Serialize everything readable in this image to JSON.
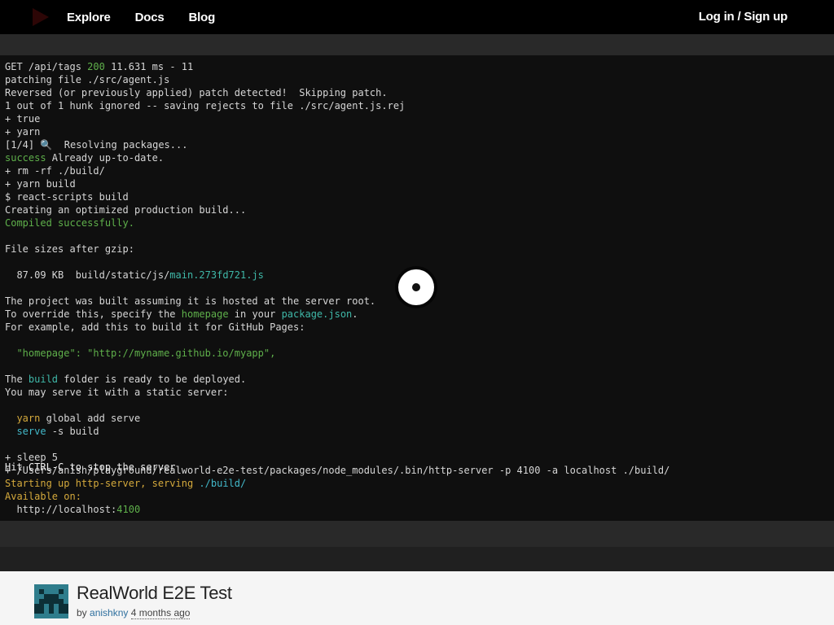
{
  "nav": {
    "links": [
      "Explore",
      "Docs",
      "Blog"
    ],
    "login": "Log in / Sign up",
    "brand_color": "#d40000"
  },
  "terminal": {
    "lines": [
      [
        {
          "t": "GET /api/tags "
        },
        {
          "t": "200",
          "c": "green"
        },
        {
          "t": " 11.631 ms - 11"
        }
      ],
      [
        {
          "t": "patching file ./src/agent.js"
        }
      ],
      [
        {
          "t": "Reversed (or previously applied) patch detected!  Skipping patch."
        }
      ],
      [
        {
          "t": "1 out of 1 hunk ignored -- saving rejects to file ./src/agent.js.rej"
        }
      ],
      [
        {
          "t": "+ true"
        }
      ],
      [
        {
          "t": "+ yarn"
        }
      ],
      [
        {
          "t": "[1/4] 🔍  Resolving packages..."
        }
      ],
      [
        {
          "t": "success",
          "c": "green"
        },
        {
          "t": " Already up-to-date."
        }
      ],
      [
        {
          "t": "+ rm -rf ./build/"
        }
      ],
      [
        {
          "t": "+ yarn build"
        }
      ],
      [
        {
          "t": "$ react-scripts build"
        }
      ],
      [
        {
          "t": "Creating an optimized production build..."
        }
      ],
      [
        {
          "t": "Compiled successfully.",
          "c": "green"
        }
      ],
      [
        {
          "t": ""
        }
      ],
      [
        {
          "t": "File sizes after gzip:"
        }
      ],
      [
        {
          "t": ""
        }
      ],
      [
        {
          "t": "  87.09 KB  build/static/js/"
        },
        {
          "t": "main.273fd721.js",
          "c": "teal"
        }
      ],
      [
        {
          "t": ""
        }
      ],
      [
        {
          "t": "The project was built assuming it is hosted at the server root."
        }
      ],
      [
        {
          "t": "To override this, specify the "
        },
        {
          "t": "homepage",
          "c": "green"
        },
        {
          "t": " in your "
        },
        {
          "t": "package.json",
          "c": "teal"
        },
        {
          "t": "."
        }
      ],
      [
        {
          "t": "For example, add this to build it for GitHub Pages:"
        }
      ],
      [
        {
          "t": ""
        }
      ],
      [
        {
          "t": "  \"homepage\": \"http://myname.github.io/myapp\",",
          "c": "green"
        }
      ],
      [
        {
          "t": ""
        }
      ],
      [
        {
          "t": "The "
        },
        {
          "t": "build",
          "c": "teal"
        },
        {
          "t": " folder is ready to be deployed."
        }
      ],
      [
        {
          "t": "You may serve it with a static server:"
        }
      ],
      [
        {
          "t": ""
        }
      ],
      [
        {
          "t": "  "
        },
        {
          "t": "yarn",
          "c": "yellow"
        },
        {
          "t": " global add serve"
        }
      ],
      [
        {
          "t": "  "
        },
        {
          "t": "serve",
          "c": "cyan"
        },
        {
          "t": " -s build"
        }
      ],
      [
        {
          "t": ""
        }
      ],
      [
        {
          "t": "+ sleep 5"
        }
      ],
      [
        {
          "t": "+ /Users/anish/playground/realworld-e2e-test/packages/node_modules/.bin/http-server -p 4100 -a localhost ./build/"
        }
      ],
      [
        {
          "t": "Starting up http-server, serving ",
          "c": "yellow"
        },
        {
          "t": "./build/",
          "c": "cyan"
        }
      ],
      [
        {
          "t": "Available on:",
          "c": "yellow"
        }
      ],
      [
        {
          "t": "  http://localhost:"
        },
        {
          "t": "4100",
          "c": "green"
        }
      ]
    ],
    "last_line": "Hit CTRL-C to stop the server"
  },
  "player": {
    "play_icon": "play-icon"
  },
  "footer": {
    "title": "RealWorld E2E Test",
    "by": "by",
    "author": "anishkny",
    "ago": "4 months ago",
    "link_color": "#2e6f9e"
  }
}
